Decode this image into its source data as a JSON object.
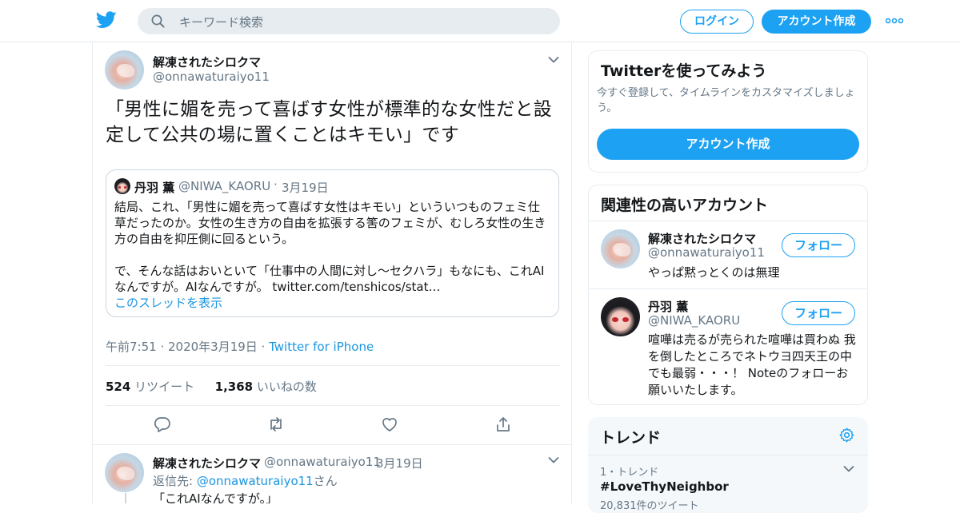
{
  "colors": {
    "brand": "#1da1f2",
    "link": "#1b95e0",
    "muted": "#657786",
    "border": "#e6ecf0"
  },
  "header": {
    "logo_icon": "twitter-bird-icon",
    "search_placeholder": "キーワード検索",
    "login_label": "ログイン",
    "signup_label": "アカウント作成",
    "more_icon": "more-dots-icon"
  },
  "tweet": {
    "author_name": "解凍されたシロクマ",
    "author_handle": "@onnawaturaiyo11",
    "text": "「男性に媚を売って喜ばす女性が標準的な女性だと設定して公共の場に置くことはキモい」です",
    "quote": {
      "name": "丹羽 薫",
      "handle": "@NIWA_KAORU",
      "dot": "·",
      "date": "3月19日",
      "body": "結局、これ、「男性に媚を売って喜ばす女性はキモい」といういつものフェミ仕草だったのか。女性の生き方の自由を拡張する筈のフェミが、むしろ女性の生き方の自由を抑圧側に回るという。\n\nで、そんな話はおいといて「仕事中の人間に対し～セクハラ」もなにも、これAIなんですが。AIなんですが。 twitter.com/tenshicos/stat…",
      "thread_link": "このスレッドを表示"
    },
    "timestamp": "午前7:51 · 2020年3月19日 · ",
    "source": "Twitter for iPhone",
    "retweet_count": "524",
    "retweet_label": "リツイート",
    "like_count": "1,368",
    "like_label": "いいねの数",
    "actions": [
      "reply-icon",
      "retweet-icon",
      "like-icon",
      "share-icon"
    ]
  },
  "reply": {
    "author_name": "解凍されたシロクマ",
    "author_handle": "@onnawaturaiyo11",
    "dot": "·",
    "date": "3月19日",
    "reply_prefix": "返信先: ",
    "reply_to": "@onnawaturaiyo11",
    "reply_suffix": "さん",
    "text": "「これAIなんですが。」"
  },
  "sidebar": {
    "signup": {
      "title": "Twitterを使ってみよう",
      "desc": "今すぐ登録して、タイムラインをカスタマイズしましょう。",
      "button": "アカウント作成"
    },
    "related": {
      "title": "関連性の高いアカウント",
      "accounts": [
        {
          "name": "解凍されたシロクマ",
          "handle": "@onnawaturaiyo11",
          "bio": "やっぱ黙っとくのは無理",
          "follow": "フォロー"
        },
        {
          "name": "丹羽 薫",
          "handle": "@NIWA_KAORU",
          "bio": "喧嘩は売るが売られた喧嘩は買わぬ 我を倒したところでネトウヨ四天王の中でも最弱・・・！ Noteのフォローお願いいたします。",
          "follow": "フォロー"
        }
      ]
    },
    "trends": {
      "title": "トレンド",
      "items": [
        {
          "rank": "1・トレンド",
          "name": "#LoveThyNeighbor",
          "count": "20,831件のツイート"
        }
      ]
    }
  }
}
